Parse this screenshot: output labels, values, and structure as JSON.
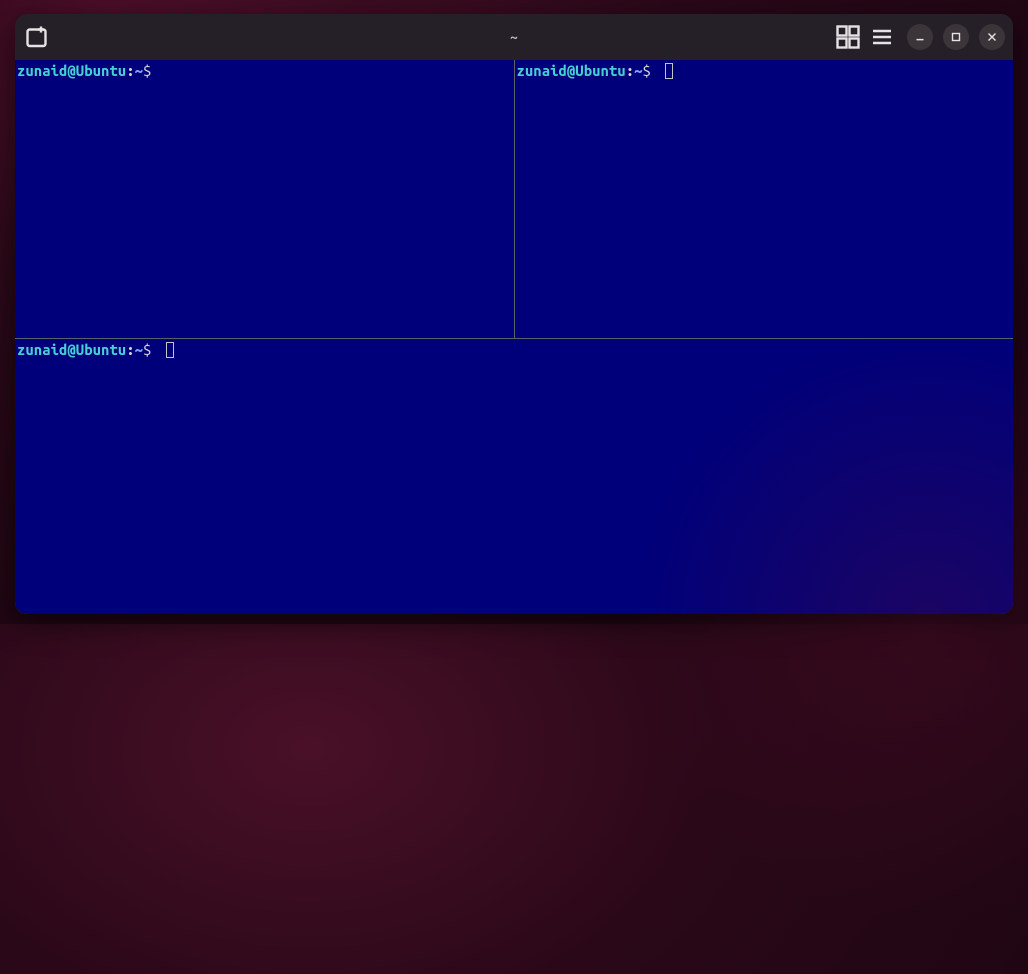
{
  "window": {
    "title": "~"
  },
  "panes": {
    "top_left": {
      "user_host": "zunaid@Ubuntu",
      "sep": ":",
      "path": "~",
      "prompt": "$ ",
      "input": "",
      "has_cursor": false
    },
    "top_right": {
      "user_host": "zunaid@Ubuntu",
      "sep": ":",
      "path": "~",
      "prompt": "$ ",
      "input": "",
      "has_cursor": true
    },
    "bottom": {
      "user_host": "zunaid@Ubuntu",
      "sep": ":",
      "path": "~",
      "prompt": "$ ",
      "input": "",
      "has_cursor": true
    }
  }
}
